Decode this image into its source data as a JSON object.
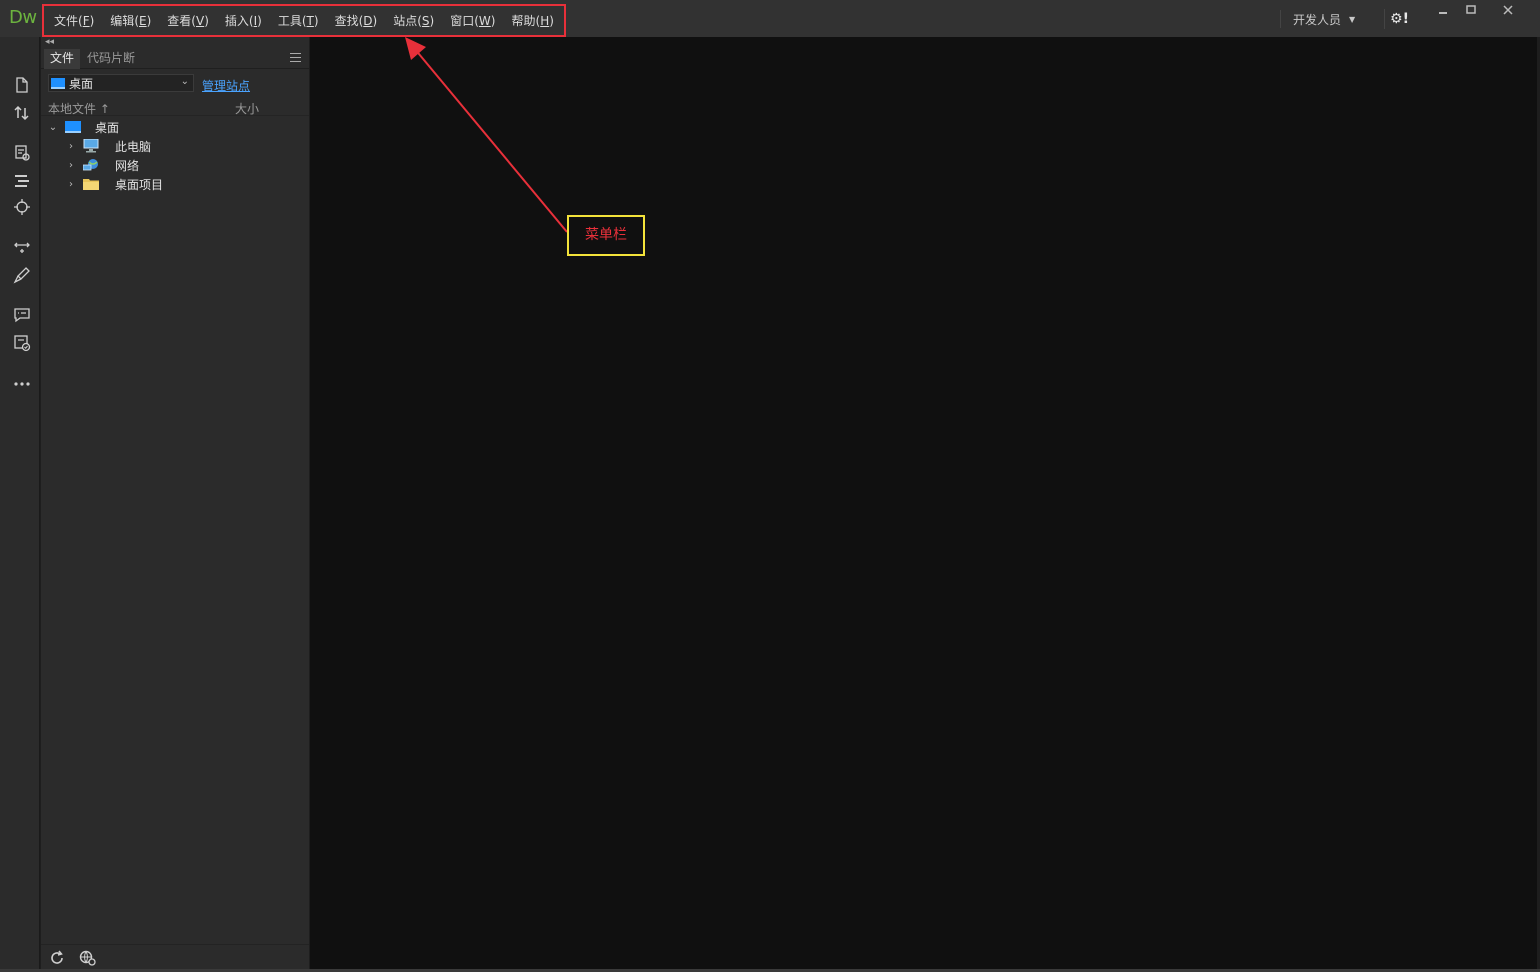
{
  "app": {
    "logo_text": "Dw"
  },
  "menubar": {
    "items": [
      {
        "label": "文件",
        "key": "F"
      },
      {
        "label": "编辑",
        "key": "E"
      },
      {
        "label": "查看",
        "key": "V"
      },
      {
        "label": "插入",
        "key": "I"
      },
      {
        "label": "工具",
        "key": "T"
      },
      {
        "label": "查找",
        "key": "D"
      },
      {
        "label": "站点",
        "key": "S"
      },
      {
        "label": "窗口",
        "key": "W"
      },
      {
        "label": "帮助",
        "key": "H"
      }
    ]
  },
  "topbar": {
    "workspace_label": "开发人员",
    "sync_label": "!",
    "window_buttons": [
      "minimize-icon",
      "maximize-icon",
      "close-icon"
    ]
  },
  "files_panel": {
    "tabs": [
      "文件",
      "代码片断"
    ],
    "site_select_value": "桌面",
    "manage_sites_link": "管理站点",
    "column_local": "本地文件",
    "column_size": "大小",
    "tree": [
      {
        "label": "桌面",
        "expanded": true,
        "icon": "desktop-icon"
      },
      {
        "label": "此电脑",
        "expanded": false,
        "icon": "computer-icon"
      },
      {
        "label": "网络",
        "expanded": false,
        "icon": "network-icon"
      },
      {
        "label": "桌面项目",
        "expanded": false,
        "icon": "folder-icon"
      }
    ]
  },
  "left_toolbar": {
    "icons": [
      "new-file-icon",
      "transfer-icon",
      "inspect-icon",
      "outline-icon",
      "target-icon",
      "resize-icon",
      "brush-icon",
      "comment-icon",
      "check-icon",
      "more-icon"
    ]
  },
  "annotation": {
    "callout_text": "菜单栏",
    "highlight_color": "#e8303a",
    "callout_border": "#f3e23a"
  },
  "colors": {
    "titlebar": "#323232",
    "panel": "#2b2b2b",
    "document": "#101010",
    "link": "#4aa3ff",
    "logo": "#6cb33f"
  }
}
